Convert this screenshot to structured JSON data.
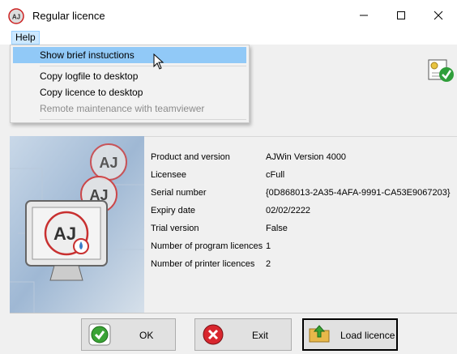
{
  "window": {
    "title": "Regular licence"
  },
  "menu": {
    "help_label": "Help",
    "items": [
      {
        "label": "Show brief instuctions",
        "highlighted": true,
        "enabled": true
      },
      {
        "label": "Copy logfile to desktop",
        "enabled": true
      },
      {
        "label": "Copy licence to desktop",
        "enabled": true
      },
      {
        "label": "Remote maintenance with teamviewer",
        "enabled": false
      }
    ]
  },
  "info": [
    {
      "label": "Product and version",
      "value": "AJWin   Version 4000"
    },
    {
      "label": "Licensee",
      "value": "cFull"
    },
    {
      "label": "Serial number",
      "value": "{0D868013-2A35-4AFA-9991-CA53E9067203}"
    },
    {
      "label": "Expiry date",
      "value": "02/02/2222"
    },
    {
      "label": "Trial version",
      "value": "False"
    },
    {
      "label": "Number of program licences",
      "value": "1"
    },
    {
      "label": "Number of printer licences",
      "value": "2"
    }
  ],
  "buttons": {
    "ok": "OK",
    "exit": "Exit",
    "load": "Load licence"
  },
  "colors": {
    "highlight": "#91c9f7",
    "ok_green": "#3aa335",
    "exit_red": "#d8262e"
  }
}
